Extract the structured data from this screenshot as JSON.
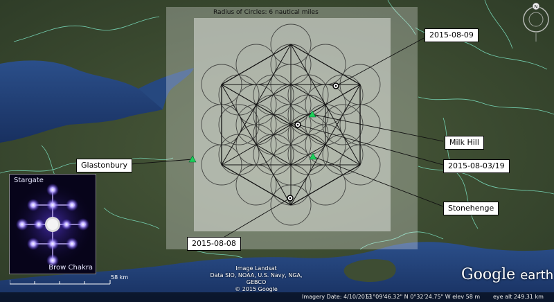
{
  "overlay": {
    "title": "Radius of Circles: 6 nautical miles"
  },
  "places": [
    {
      "id": "glastonbury",
      "name": "Glastonbury"
    },
    {
      "id": "milk-hill",
      "name": "Milk Hill"
    },
    {
      "id": "stonehenge",
      "name": "Stonehenge"
    }
  ],
  "dates": {
    "d1": "2015-08-09",
    "d2": "2015-08-03/19",
    "d3": "2015-08-08"
  },
  "inset": {
    "title": "Stargate",
    "caption": "Brow Chakra"
  },
  "scale": {
    "label": "58 km"
  },
  "attribution": {
    "line1": "Image Landsat",
    "line2": "Data SIO, NOAA, U.S. Navy, NGA, GEBCO",
    "line3": "© 2015 Google"
  },
  "status": {
    "imagery_date": "Imagery Date: 4/10/2013",
    "coords": "51°09'46.32\" N    0°32'24.75\" W  elev   58 m",
    "eye_alt": "eye alt 249.31 km"
  },
  "logo": {
    "google": "Google",
    "earth": "earth"
  },
  "nav": {
    "north": "N"
  },
  "colors": {
    "land": "#3b4a30",
    "sea": "#1e3a6e",
    "boundary": "#7fe8c8",
    "overlay": "#ffffff",
    "marker_green": "#1fd15a"
  }
}
